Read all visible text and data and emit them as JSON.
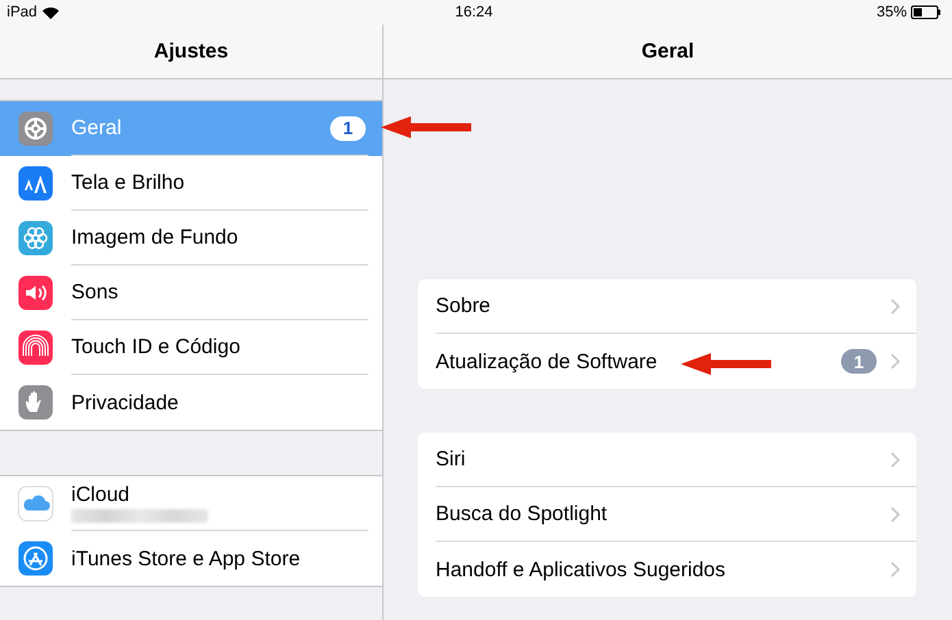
{
  "status_bar": {
    "device": "iPad",
    "time": "16:24",
    "battery": "35%"
  },
  "sidebar": {
    "title": "Ajustes",
    "sections": [
      {
        "items": [
          {
            "label": "Geral",
            "selected": true,
            "badge": "1"
          },
          {
            "label": "Tela e Brilho",
            "selected": false
          },
          {
            "label": "Imagem de Fundo",
            "selected": false
          },
          {
            "label": "Sons",
            "selected": false
          },
          {
            "label": "Touch ID e Código",
            "selected": false
          },
          {
            "label": "Privacidade",
            "selected": false
          }
        ]
      },
      {
        "items": [
          {
            "label": "iCloud",
            "selected": false,
            "redacted_subtitle": true
          },
          {
            "label": "iTunes Store e App Store",
            "selected": false
          }
        ]
      }
    ]
  },
  "detail": {
    "title": "Geral",
    "groups": [
      {
        "items": [
          {
            "label": "Sobre"
          },
          {
            "label": "Atualização de Software",
            "badge": "1"
          }
        ]
      },
      {
        "items": [
          {
            "label": "Siri"
          },
          {
            "label": "Busca do Spotlight"
          },
          {
            "label": "Handoff e Aplicativos Sugeridos"
          }
        ]
      }
    ]
  }
}
